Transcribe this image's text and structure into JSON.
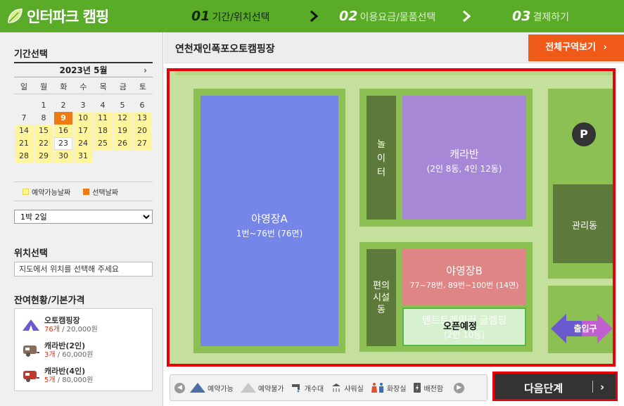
{
  "brand": {
    "logo_text": "인터파크 캠핑"
  },
  "steps": [
    {
      "num": "01",
      "label": "기간/위치선택"
    },
    {
      "num": "02",
      "label": "이용요금/물품선택"
    },
    {
      "num": "03",
      "label": "결제하기"
    }
  ],
  "sidebar": {
    "period_title": "기간선택",
    "calendar": {
      "month_label": "2023년  5월",
      "next_icon": "chevron-right-icon",
      "weekdays": [
        "일",
        "월",
        "화",
        "수",
        "목",
        "금",
        "토"
      ],
      "days": [
        "",
        "1",
        "2",
        "3",
        "4",
        "5",
        "6",
        "7",
        "8",
        "9",
        "10",
        "11",
        "12",
        "13",
        "14",
        "15",
        "16",
        "17",
        "18",
        "19",
        "20",
        "21",
        "22",
        "23",
        "24",
        "25",
        "26",
        "27",
        "28",
        "29",
        "30",
        "31"
      ],
      "selected_day": "9",
      "today_day": "23",
      "available_from": 9
    },
    "legend": {
      "available": "예약가능날짜",
      "selected": "선택날짜"
    },
    "stay_select": {
      "value": "1박 2일"
    },
    "location_title": "위치선택",
    "location_hint": "지도에서 위치를 선택해 주세요",
    "pricing_title": "잔여현황/기본가격",
    "pricing": [
      {
        "name": "오토캠핑장",
        "count": "76개",
        "price": " / 20,000원",
        "icon": "tent-icon"
      },
      {
        "name": "캐라반(2인)",
        "count": "3개",
        "price": " / 60,000원",
        "icon": "caravan-icon"
      },
      {
        "name": "캐라반(4인)",
        "count": "5개",
        "price": " / 80,000원",
        "icon": "caravan-icon"
      }
    ]
  },
  "main": {
    "site_name": "연천재인폭포오토캠핑장",
    "view_all_label": "전체구역보기",
    "map": {
      "zone_a": {
        "title": "야영장A",
        "sub": "1번~76번 (76면)"
      },
      "playground": "놀이터",
      "caravan": {
        "title": "캐라반",
        "sub": "(2인 8동, 4인 12동)"
      },
      "parking": "P",
      "office": "관리동",
      "facilities": "편의시설동",
      "zone_b": {
        "title": "야영장B",
        "sub": "77~78번, 89번~100번 (14면)"
      },
      "glamping": {
        "title": "텐트트레일러 글램핑",
        "sub": "(2인 10동)",
        "badge": "오픈예정"
      },
      "entrance": "출입구"
    },
    "icon_legend": [
      {
        "label": "예약가능",
        "icon": "tent-available-icon"
      },
      {
        "label": "예약불가",
        "icon": "tent-unavailable-icon"
      },
      {
        "label": "개수대",
        "icon": "faucet-icon"
      },
      {
        "label": "샤워실",
        "icon": "shower-icon"
      },
      {
        "label": "화장실",
        "icon": "restroom-icon"
      },
      {
        "label": "배전함",
        "icon": "power-box-icon"
      }
    ],
    "next_label": "다음단계"
  },
  "colors": {
    "header": "#5aab28",
    "zone_a": "#7585e8",
    "caravan": "#a688d6",
    "zone_b": "#e08585",
    "building": "#5e7a3a",
    "selected_day": "#f07a12",
    "available_day": "#fff59d",
    "highlight_border": "#e8000a"
  }
}
